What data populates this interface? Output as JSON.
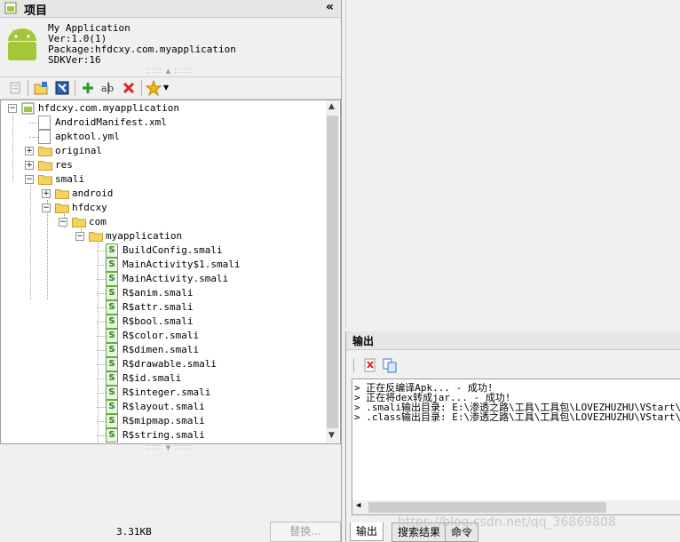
{
  "project_panel": {
    "title": "项目",
    "collapse_glyph": "«",
    "app_info": {
      "name": "My Application",
      "version": "Ver:1.0(1)",
      "package": "Package:hfdcxy.com.myapplication",
      "sdk": "SDKVer:16"
    },
    "toolbar_icons": [
      "properties-icon",
      "open-folder-icon",
      "import-icon",
      "add-icon",
      "rename-icon",
      "delete-icon",
      "favorite-icon",
      "dropdown-icon"
    ],
    "tree": [
      {
        "label": "hfdcxy.com.myapplication",
        "type": "project",
        "depth": 0,
        "expander": "-"
      },
      {
        "label": "AndroidManifest.xml",
        "type": "file",
        "depth": 1
      },
      {
        "label": "apktool.yml",
        "type": "file",
        "depth": 1
      },
      {
        "label": "original",
        "type": "folder",
        "depth": 1,
        "expander": "+"
      },
      {
        "label": "res",
        "type": "folder",
        "depth": 1,
        "expander": "+"
      },
      {
        "label": "smali",
        "type": "folder",
        "depth": 1,
        "expander": "-"
      },
      {
        "label": "android",
        "type": "folder",
        "depth": 2,
        "expander": "+"
      },
      {
        "label": "hfdcxy",
        "type": "folder",
        "depth": 2,
        "expander": "-"
      },
      {
        "label": "com",
        "type": "folder",
        "depth": 3,
        "expander": "-"
      },
      {
        "label": "myapplication",
        "type": "folder",
        "depth": 4,
        "expander": "-"
      },
      {
        "label": "BuildConfig.smali",
        "type": "smali",
        "depth": 5
      },
      {
        "label": "MainActivity$1.smali",
        "type": "smali",
        "depth": 5
      },
      {
        "label": "MainActivity.smali",
        "type": "smali",
        "depth": 5
      },
      {
        "label": "R$anim.smali",
        "type": "smali",
        "depth": 5
      },
      {
        "label": "R$attr.smali",
        "type": "smali",
        "depth": 5
      },
      {
        "label": "R$bool.smali",
        "type": "smali",
        "depth": 5
      },
      {
        "label": "R$color.smali",
        "type": "smali",
        "depth": 5
      },
      {
        "label": "R$dimen.smali",
        "type": "smali",
        "depth": 5
      },
      {
        "label": "R$drawable.smali",
        "type": "smali",
        "depth": 5
      },
      {
        "label": "R$id.smali",
        "type": "smali",
        "depth": 5
      },
      {
        "label": "R$integer.smali",
        "type": "smali",
        "depth": 5
      },
      {
        "label": "R$layout.smali",
        "type": "smali",
        "depth": 5
      },
      {
        "label": "R$mipmap.smali",
        "type": "smali",
        "depth": 5
      },
      {
        "label": "R$string.smali",
        "type": "smali",
        "depth": 5
      }
    ],
    "status_size": "3.31KB",
    "replace_button": "替换..."
  },
  "output_panel": {
    "title": "输出",
    "toolbar_icons": [
      "clear-icon",
      "copy-icon"
    ],
    "lines": [
      "> 正在反编译Apk...  - 成功!",
      "> 正在将dex转成jar...  - 成功!",
      "> .smali输出目录: E:\\渗透之路\\工具\\工具包\\LOVEZHUZHU\\VStart\\U",
      "> .class输出目录: E:\\渗透之路\\工具\\工具包\\LOVEZHUZHU\\VStart\\U"
    ],
    "tabs": [
      "输出",
      "搜索结果",
      "命令"
    ],
    "active_tab": "输出"
  },
  "watermark": "https://blog.csdn.net/qq_36869808",
  "colors": {
    "android_green": "#a4c639",
    "smali_green": "#2f7d1e",
    "folder_yellow": "#f4d35e",
    "delete_red": "#e02020",
    "add_green": "#2a9d2a"
  }
}
